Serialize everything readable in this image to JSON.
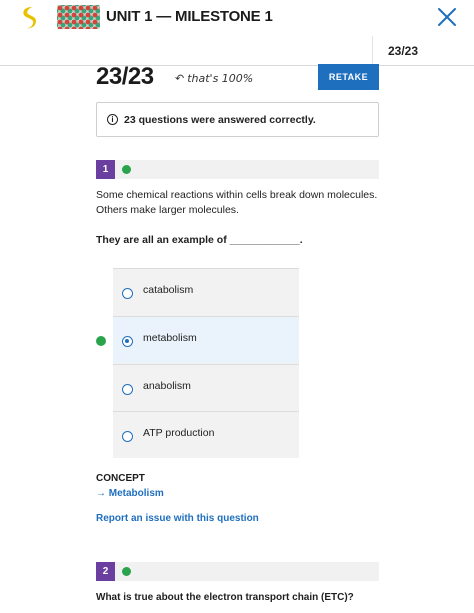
{
  "header": {
    "unit_title": "UNIT 1 — MILESTONE 1",
    "score_small": "23/23"
  },
  "summary": {
    "score": "23/23",
    "annotation": "that's 100%",
    "retake_label": "RETAKE",
    "notice": "23 questions were answered correctly."
  },
  "questions": [
    {
      "number": "1",
      "text_line1": "Some chemical reactions within cells break down molecules.",
      "text_line2": "Others make larger molecules.",
      "prompt": "They are all an example of ____________.",
      "options": [
        {
          "label": "catabolism",
          "selected": false
        },
        {
          "label": "metabolism",
          "selected": true
        },
        {
          "label": "anabolism",
          "selected": false
        },
        {
          "label": "ATP production",
          "selected": false
        }
      ],
      "concept_heading": "CONCEPT",
      "concept_link": "→ Metabolism",
      "report_link": "Report an issue with this question"
    },
    {
      "number": "2",
      "text_line1": "What is true about the electron transport chain (ETC)?"
    }
  ],
  "colors": {
    "accent": "#1f6fbf",
    "question_badge": "#6b3fa0",
    "correct": "#2aa44c",
    "logo": "#e8c200"
  }
}
